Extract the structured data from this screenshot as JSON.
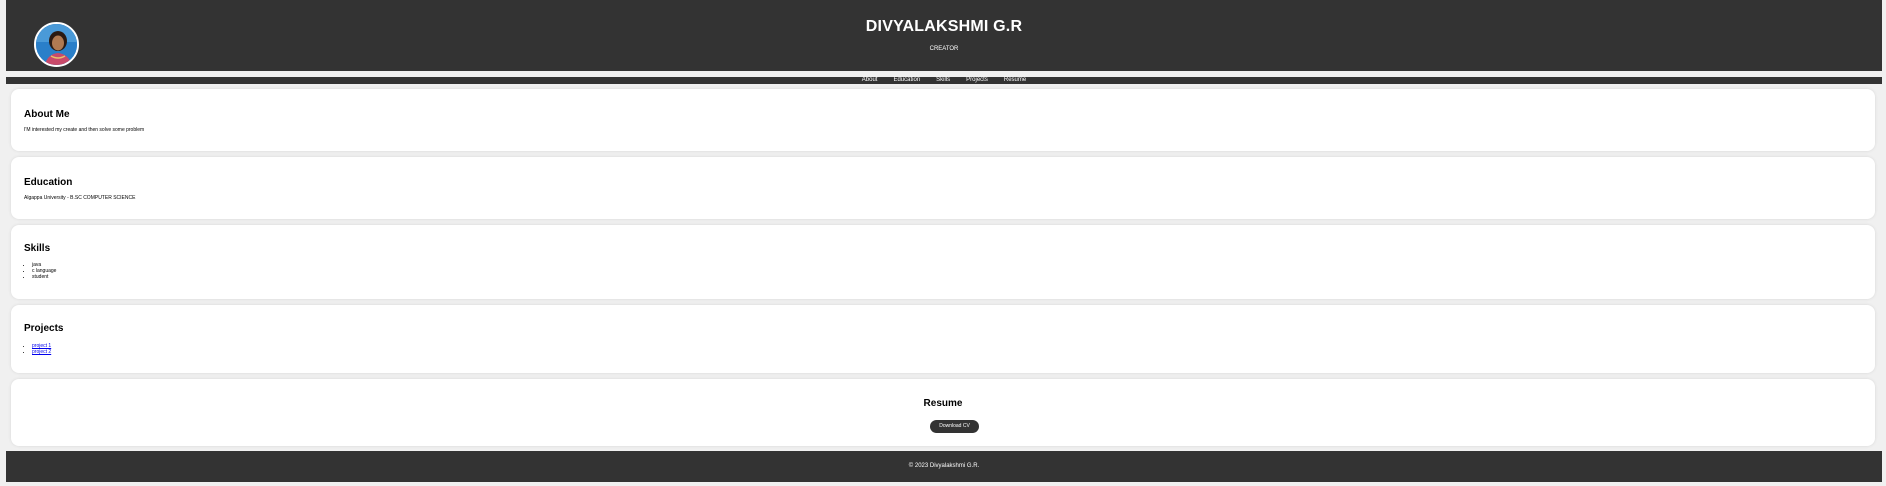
{
  "header": {
    "name": "DIVYALAKSHMI G.R",
    "tagline": "CREATOR"
  },
  "nav": {
    "items": [
      {
        "label": "About"
      },
      {
        "label": "Education"
      },
      {
        "label": "Skills"
      },
      {
        "label": "Projects"
      },
      {
        "label": "Resume"
      }
    ]
  },
  "about": {
    "title": "About Me",
    "text": "I'M interested my create and then solve some problem"
  },
  "education": {
    "title": "Education",
    "text": "Algappa University - B.SC COMPUTER SCIENCE"
  },
  "skills": {
    "title": "Skills",
    "items": [
      "java",
      "c language",
      "student"
    ]
  },
  "projects": {
    "title": "Projects",
    "items": [
      "project 1",
      "project 2"
    ]
  },
  "resume": {
    "title": "Resume",
    "button_label": "Download CV"
  },
  "footer": {
    "text": "© 2023 Divyalakshmi G.R."
  },
  "colors": {
    "header_bg": "#333333",
    "page_bg": "#f0f0f0",
    "card_bg": "#ffffff",
    "link": "#0000ee"
  }
}
